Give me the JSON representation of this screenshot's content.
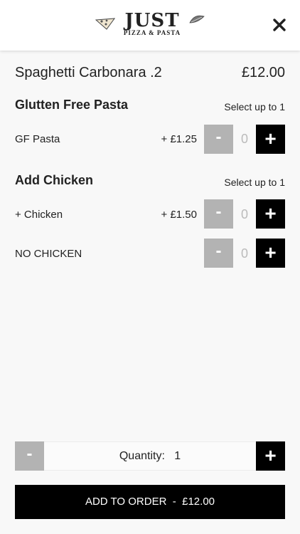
{
  "header": {
    "logo_text": "JUST",
    "logo_subtitle": "PIZZA & PASTA",
    "close_icon": "close-icon"
  },
  "item": {
    "name": "Spaghetti Carbonara .2",
    "price": "£12.00"
  },
  "groups": [
    {
      "title": "Glutten Free Pasta",
      "hint": "Select up to 1",
      "options": [
        {
          "label": "GF Pasta",
          "price": "+ £1.25",
          "count": "0",
          "minus": "-",
          "plus": "+"
        }
      ]
    },
    {
      "title": "Add Chicken",
      "hint": "Select up to 1",
      "options": [
        {
          "label": "+ Chicken",
          "price": "+ £1.50",
          "count": "0",
          "minus": "-",
          "plus": "+"
        },
        {
          "label": "NO CHICKEN",
          "price": "",
          "count": "0",
          "minus": "-",
          "plus": "+"
        }
      ]
    }
  ],
  "quantity": {
    "label": "Quantity:",
    "value": "1",
    "minus": "-",
    "plus": "+"
  },
  "add_to_order": {
    "label": "ADD TO ORDER",
    "separator": "-",
    "price": "£12.00"
  },
  "colors": {
    "minus_button": "#b3b3b3",
    "plus_button": "#000000",
    "add_button": "#000000"
  }
}
